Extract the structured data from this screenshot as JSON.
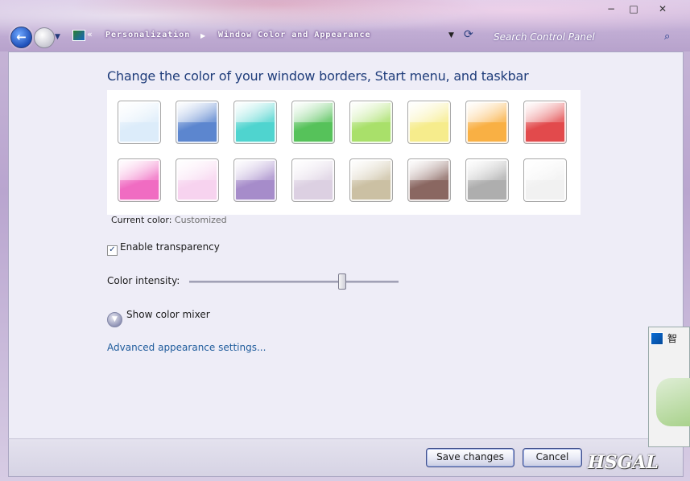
{
  "window": {
    "minimize_glyph": "−",
    "maximize_glyph": "□",
    "close_glyph": "✕"
  },
  "nav": {
    "back_glyph": "←",
    "dropdown_glyph": "▼",
    "breadcrumb_sep": "«",
    "crumbs": [
      "Personalization",
      "Window Color and Appearance"
    ],
    "crumb_arrow": "▶",
    "address_dropdown": "▼",
    "refresh_glyph": "⟳",
    "search_placeholder": "Search Control Panel",
    "search_glyph": "⌕"
  },
  "main": {
    "heading": "Change the color of your window borders, Start menu, and taskbar",
    "swatches": [
      {
        "name": "sky",
        "color": "#dcecfa"
      },
      {
        "name": "twilight",
        "color": "#5c86cf"
      },
      {
        "name": "sea",
        "color": "#4fd4cf"
      },
      {
        "name": "leaf",
        "color": "#56c25a"
      },
      {
        "name": "lime",
        "color": "#a9e06a"
      },
      {
        "name": "lemon",
        "color": "#f6ec8c"
      },
      {
        "name": "pumpkin",
        "color": "#f9b044"
      },
      {
        "name": "ruby",
        "color": "#e24a4c"
      },
      {
        "name": "fuchsia",
        "color": "#f06cc2"
      },
      {
        "name": "blush",
        "color": "#f7d3ef"
      },
      {
        "name": "violet",
        "color": "#a68cca"
      },
      {
        "name": "lavender",
        "color": "#dcd0e2"
      },
      {
        "name": "taupe",
        "color": "#cbc0a3"
      },
      {
        "name": "chocolate",
        "color": "#8a6761"
      },
      {
        "name": "slate",
        "color": "#aeaeae"
      },
      {
        "name": "frost",
        "color": "#f1f1f1"
      }
    ],
    "current_color_label": "Current color:",
    "current_color_value": "Customized",
    "transparency_label": "Enable transparency",
    "transparency_checked": true,
    "check_glyph": "✓",
    "intensity_label": "Color intensity:",
    "intensity_fraction": 0.73,
    "mixer_label": "Show color mixer",
    "mixer_glyph": "▼",
    "advanced_link": "Advanced appearance settings..."
  },
  "footer": {
    "save_label": "Save changes",
    "cancel_label": "Cancel"
  },
  "overlay": {
    "side_text": "智",
    "watermark": "HSGAL"
  }
}
